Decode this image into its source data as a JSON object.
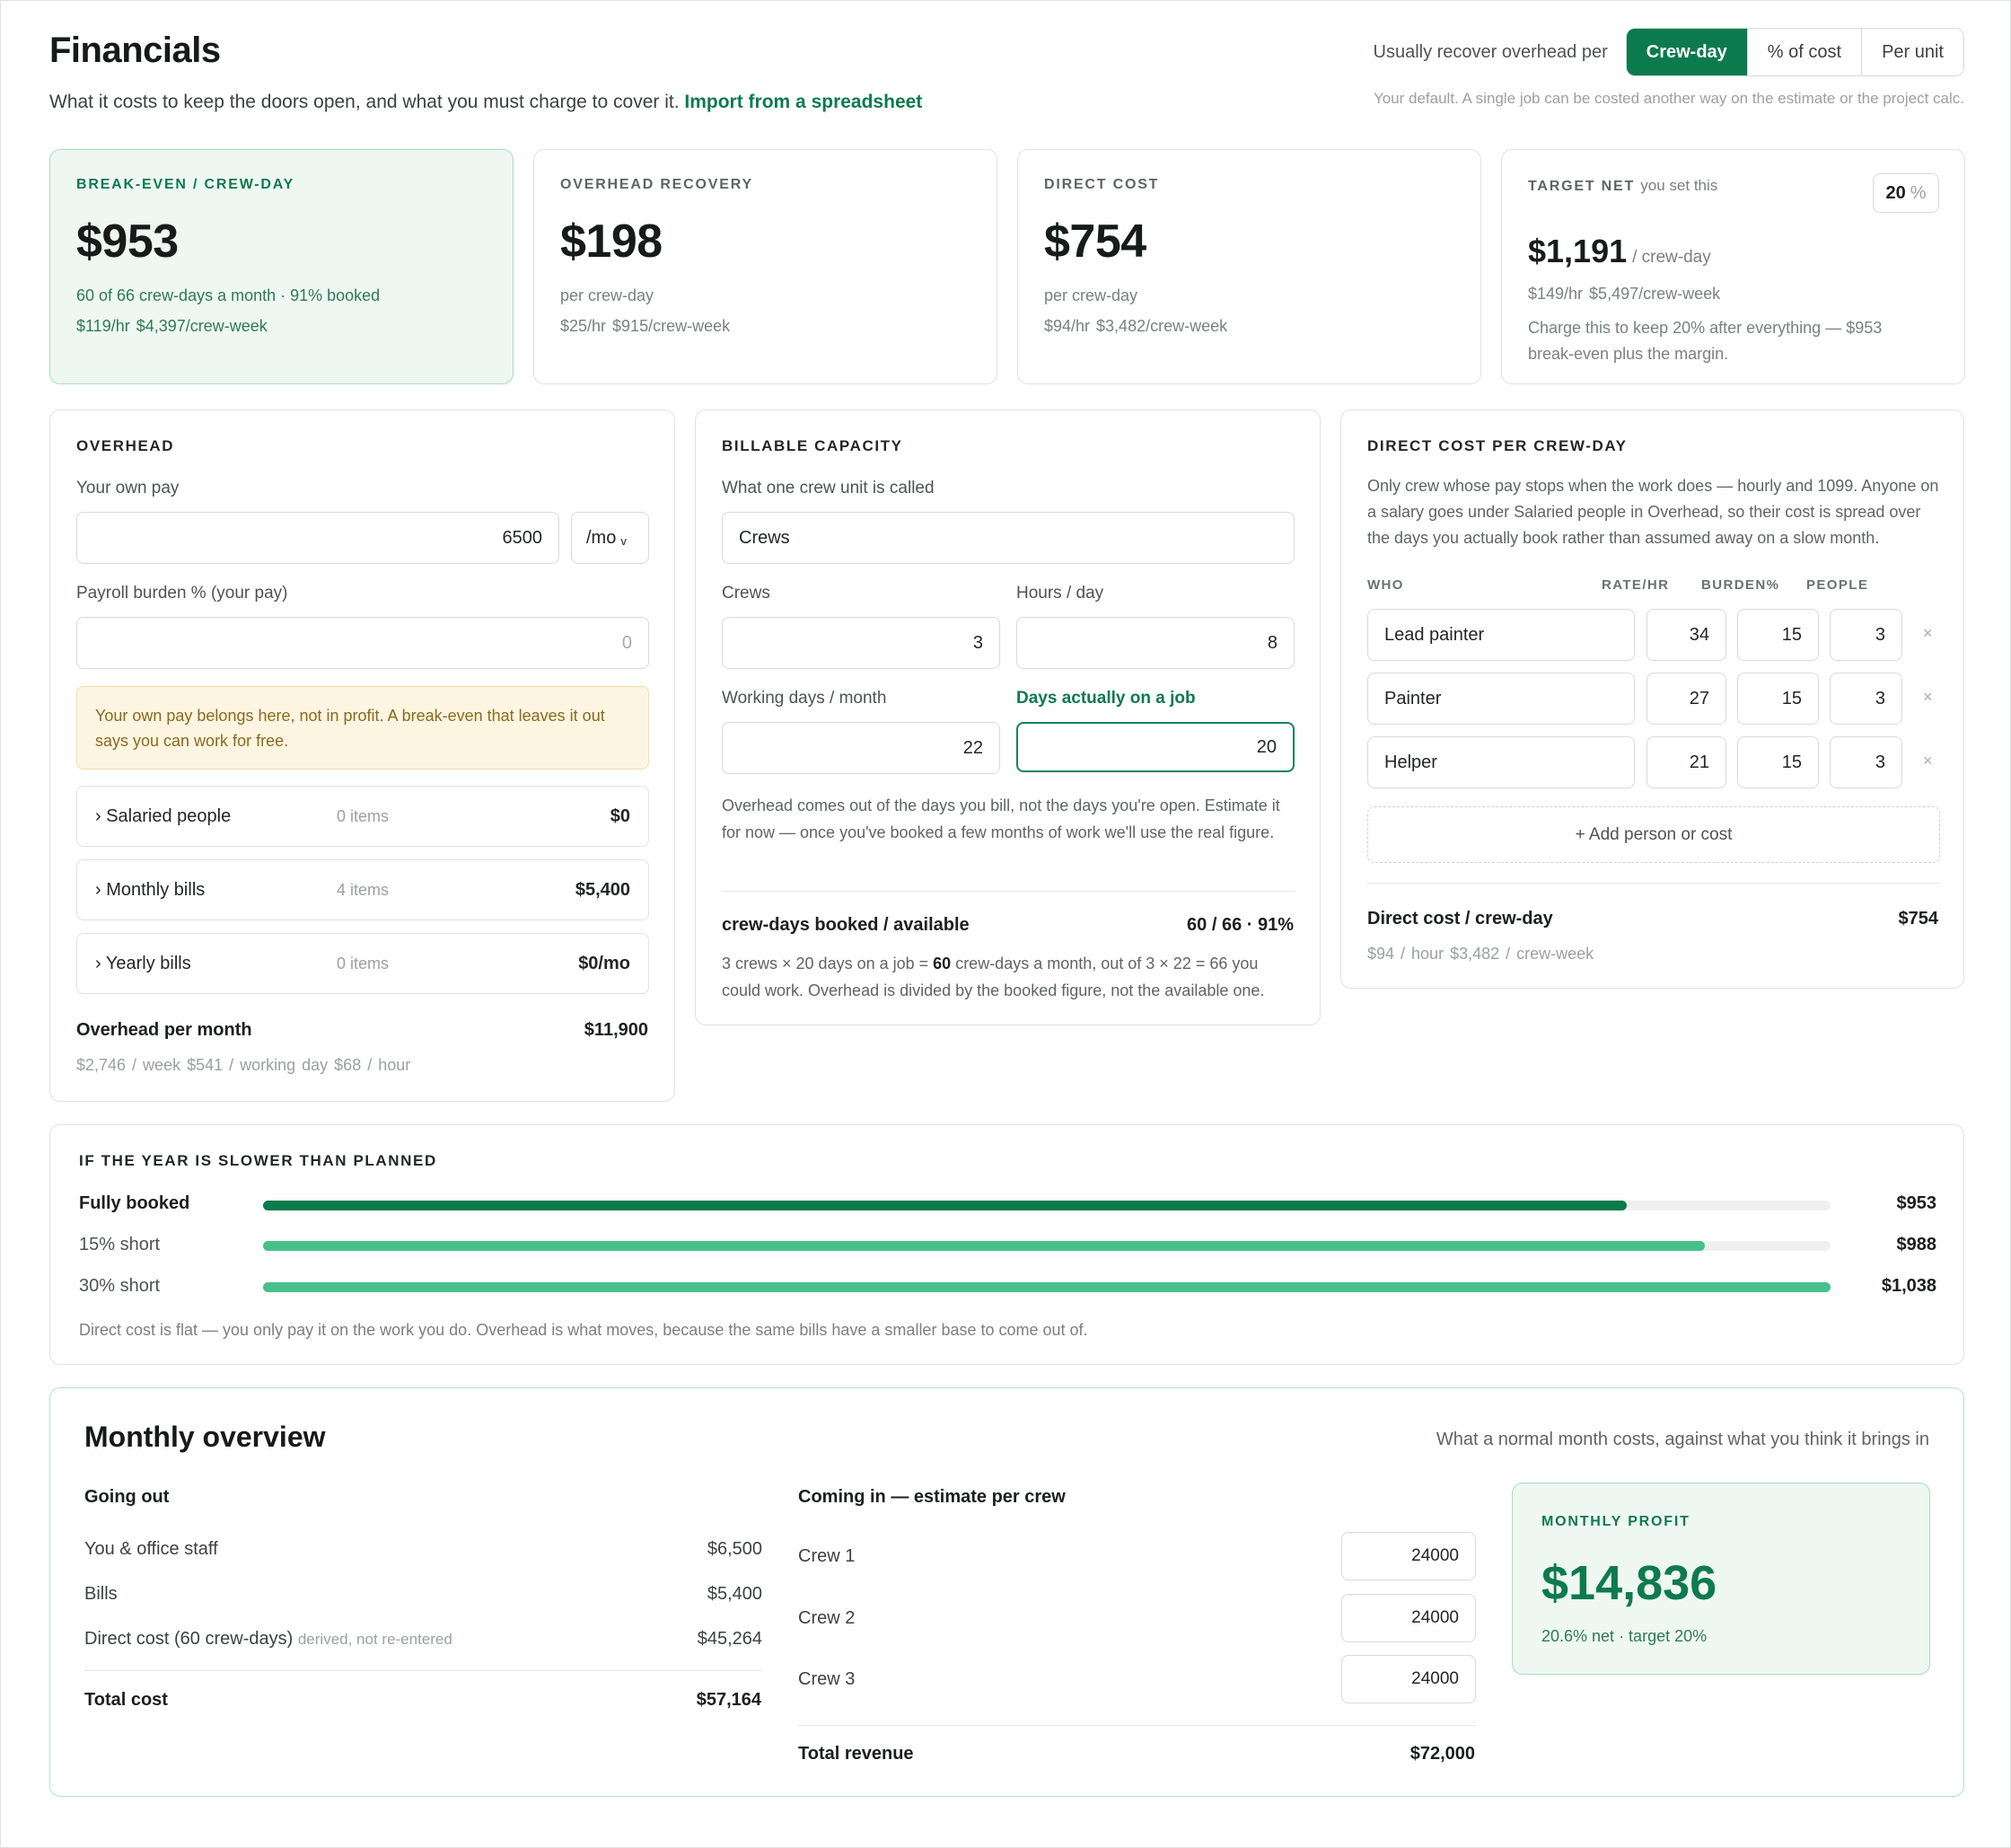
{
  "header": {
    "title": "Financials",
    "subtitle": "What it costs to keep the doors open, and what you must charge to cover it.",
    "import_link": "Import from a spreadsheet",
    "recover_label": "Usually recover overhead per",
    "recover_options": [
      "Crew-day",
      "% of cost",
      "Per unit"
    ],
    "recover_selected": "Crew-day",
    "default_note": "Your default. A single job can be costed another way on the estimate or the project calc."
  },
  "kpis": {
    "breakeven": {
      "label": "BREAK-EVEN / CREW-DAY",
      "value": "$953",
      "line1": "60 of 66 crew-days a month · 91% booked",
      "line2": "$119/hr   $4,397/crew-week"
    },
    "overhead": {
      "label": "OVERHEAD RECOVERY",
      "value": "$198",
      "line1": "per crew-day",
      "line2": "$25/hr   $915/crew-week"
    },
    "direct": {
      "label": "DIRECT COST",
      "value": "$754",
      "line1": "per crew-day",
      "line2": "$94/hr   $3,482/crew-week"
    },
    "target": {
      "label": "TARGET NET",
      "label_sub": "you set this",
      "pct": "20",
      "pct_unit": "%",
      "value": "$1,191",
      "value_unit": "/ crew-day",
      "line1": "$149/hr   $5,497/crew-week",
      "line2": "Charge this to keep 20% after everything — $953 break-even plus the margin."
    }
  },
  "overhead": {
    "heading": "OVERHEAD",
    "own_pay_label": "Your own pay",
    "own_pay_value": "6500",
    "period": "/mo",
    "burden_label": "Payroll burden % (your pay)",
    "burden_placeholder": "0",
    "warning": "Your own pay belongs here, not in profit. A break-even that leaves it out says you can work for free.",
    "groups": [
      {
        "name": "› Salaried people",
        "count": "0 items",
        "value": "$0"
      },
      {
        "name": "› Monthly bills",
        "count": "4 items",
        "value": "$5,400"
      },
      {
        "name": "› Yearly bills",
        "count": "0 items",
        "value": "$0/mo"
      }
    ],
    "total_label": "Overhead per month",
    "total_value": "$11,900",
    "total_sub": "$2,746 / week   $541 / working day   $68 / hour"
  },
  "capacity": {
    "heading": "BILLABLE CAPACITY",
    "unit_label": "What one crew unit is called",
    "unit_value": "Crews",
    "crews_label": "Crews",
    "crews_value": "3",
    "hours_label": "Hours / day",
    "hours_value": "8",
    "wd_label": "Working days / month",
    "wd_value": "22",
    "days_label": "Days actually on a job",
    "days_value": "20",
    "note": "Overhead comes out of the days you bill, not the days you're open. Estimate it for now — once you've booked a few months of work we'll use the real figure.",
    "booked_label": "crew-days booked / available",
    "booked_value": "60 / 66 · 91%",
    "explain_pre": "3 crews × 20 days on a job = ",
    "explain_bold": "60",
    "explain_post": " crew-days a month, out of 3 × 22 = 66 you could work. Overhead is divided by the booked figure, not the available one."
  },
  "direct": {
    "heading": "DIRECT COST PER CREW-DAY",
    "note": "Only crew whose pay stops when the work does — hourly and 1099. Anyone on a salary goes under Salaried people in Overhead, so their cost is spread over the days you actually book rather than assumed away on a slow month.",
    "cols": [
      "WHO",
      "RATE/HR",
      "BURDEN%",
      "PEOPLE"
    ],
    "rows": [
      {
        "who": "Lead painter",
        "rate": "34",
        "burden": "15",
        "people": "3"
      },
      {
        "who": "Painter",
        "rate": "27",
        "burden": "15",
        "people": "3"
      },
      {
        "who": "Helper",
        "rate": "21",
        "burden": "15",
        "people": "3"
      }
    ],
    "remove_glyph": "×",
    "add_label": "+ Add person or cost",
    "total_label": "Direct cost / crew-day",
    "total_value": "$754",
    "total_sub": "$94 / hour   $3,482 / crew-week"
  },
  "slow": {
    "heading": "IF THE YEAR IS SLOWER THAN PLANNED",
    "rows": [
      {
        "label": "Fully booked",
        "value": "$953",
        "fill": 0.87,
        "color": "#0b7a4c"
      },
      {
        "label": "15% short",
        "value": "$988",
        "fill": 0.92,
        "color": "#46c08a"
      },
      {
        "label": "30% short",
        "value": "$1,038",
        "fill": 1.0,
        "color": "#46c08a"
      }
    ],
    "note": "Direct cost is flat — you only pay it on the work you do. Overhead is what moves, because the same bills have a smaller base to come out of."
  },
  "monthly": {
    "title": "Monthly overview",
    "tagline": "What a normal month costs, against what you think it brings in",
    "out_heading": "Going out",
    "out_rows": [
      {
        "label": "You & office staff",
        "note": "",
        "value": "$6,500"
      },
      {
        "label": "Bills",
        "note": "",
        "value": "$5,400"
      },
      {
        "label": "Direct cost (60 crew-days)",
        "note": "derived, not re-entered",
        "value": "$45,264"
      }
    ],
    "total_cost_label": "Total cost",
    "total_cost_value": "$57,164",
    "in_heading": "Coming in — estimate per crew",
    "in_rows": [
      {
        "label": "Crew 1",
        "value": "24000"
      },
      {
        "label": "Crew 2",
        "value": "24000"
      },
      {
        "label": "Crew 3",
        "value": "24000"
      }
    ],
    "total_rev_label": "Total revenue",
    "total_rev_value": "$72,000",
    "profit_label": "MONTHLY PROFIT",
    "profit_value": "$14,836",
    "profit_sub": "20.6% net · target 20%"
  },
  "colors": {
    "accent": "#0b7a4c",
    "accent_light": "#46c08a",
    "highlight_bg": "#eef7f2",
    "warning_bg": "#fdf5e2"
  }
}
